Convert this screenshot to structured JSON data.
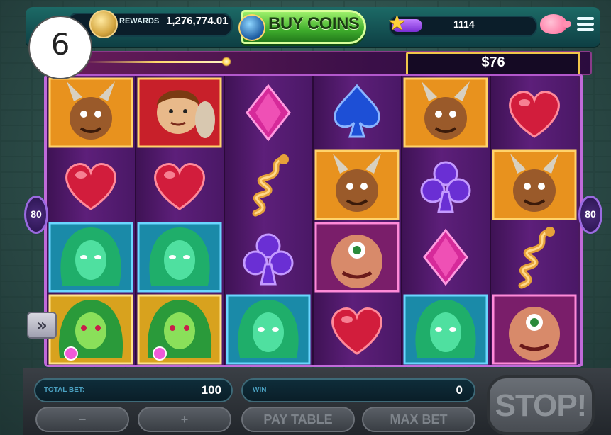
{
  "header": {
    "rewards_label": "REWARDS",
    "rewards_value": "1,276,774.01",
    "buy_coins_label": "BUY COINS",
    "level_value": "1114",
    "level_progress": 0.22
  },
  "jackpot": {
    "value": "$76"
  },
  "step_badge": "6",
  "paylines": {
    "left": "80",
    "right": "80"
  },
  "fast_spin_icon": "»",
  "reels": [
    [
      "devil-satyr",
      "heart",
      "medusa-blue",
      "medusa-green-gold"
    ],
    [
      "hero-warrior",
      "heart",
      "medusa-blue",
      "medusa-green-gold"
    ],
    [
      "diamond",
      "snake-coil",
      "club",
      "medusa-blue"
    ],
    [
      "spade",
      "devil-satyr",
      "cyclops",
      "heart"
    ],
    [
      "devil-satyr",
      "club",
      "diamond",
      "medusa-blue"
    ],
    [
      "heart",
      "devil-satyr",
      "snake-coil",
      "cyclops"
    ]
  ],
  "footer": {
    "total_bet_label": "TOTAL BET:",
    "total_bet_value": "100",
    "win_label": "WIN",
    "win_value": "0",
    "minus_label": "−",
    "plus_label": "+",
    "pay_table_label": "PAY TABLE",
    "max_bet_label": "MAX BET",
    "stop_label": "STOP!"
  },
  "colors": {
    "reel_bg": "#4a1a5e",
    "frame": "#c06ad9",
    "buy_coins": "#3fae2c",
    "jackpot_border": "#f0c64a"
  }
}
